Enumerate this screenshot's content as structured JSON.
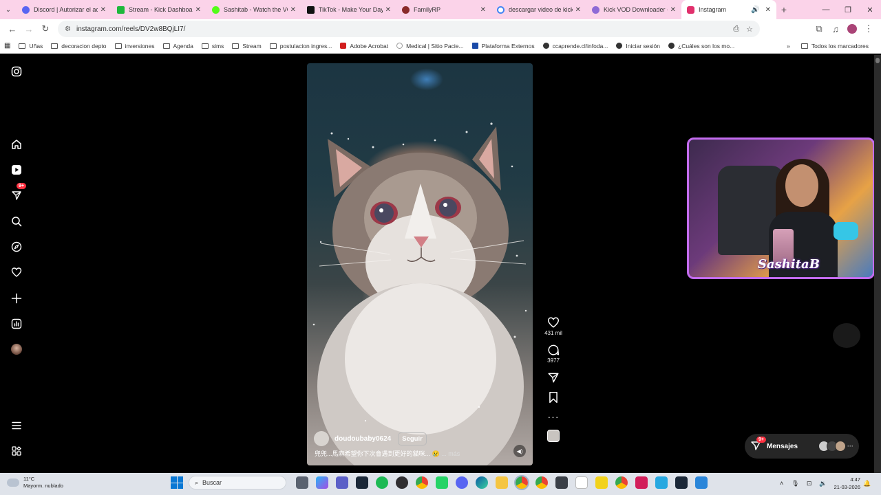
{
  "browser": {
    "tabs": [
      {
        "title": "Discord | Autorizar el acceso",
        "color": "#5865f2"
      },
      {
        "title": "Stream - Kick Dashboard",
        "color": "#1eb83c"
      },
      {
        "title": "Sashitab - Watch the VOD",
        "color": "#53fc18"
      },
      {
        "title": "TikTok - Make Your Day",
        "color": "#111111"
      },
      {
        "title": "FamilyRP",
        "color": "#8a2a2a"
      },
      {
        "title": "descargar video de kick - Google",
        "color": "#4285f4"
      },
      {
        "title": "Kick VOD Downloader - S",
        "color": "#8e6ad6"
      },
      {
        "title": "Instagram",
        "color": "#e1306c",
        "active": true
      }
    ],
    "url": "instagram.com/reels/DV2w8BQjLI7/",
    "bookmarks": [
      "Uñas",
      "decoracion depto",
      "inversiones",
      "Agenda",
      "sims",
      "Stream",
      "postulacion ingres...",
      "Adobe Acrobat",
      "Medical | Sitio Pacie...",
      "Plataforma Externos",
      "ccaprende.cl/infoda...",
      "Iniciar sesión",
      "¿Cuáles son los mo..."
    ],
    "bookmarks_more": "»",
    "all_bookmarks": "Todos los marcadores"
  },
  "instagram": {
    "nav": [
      "instagram-icon",
      "home-icon",
      "reels-icon",
      "messages-icon",
      "search-icon",
      "explore-icon",
      "notifications-icon",
      "create-icon",
      "dashboard-icon",
      "profile-avatar"
    ],
    "messages_badge": "9+",
    "reel": {
      "username": "doudoubaby0624",
      "follow_label": "Seguir",
      "caption": "兜兜...馬麻希望你下次會遇到更好的貓咪...",
      "more_label": "... más",
      "likes": "431 mil",
      "comments": "3977"
    },
    "messages_label": "Mensajes",
    "messages_count": "9+",
    "overlay_brand": "SashitaB"
  },
  "taskbar": {
    "weather_temp": "11°C",
    "weather_desc": "Mayorm. nublado",
    "search_label": "Buscar",
    "time": "4:47",
    "date": "21-03-2026"
  }
}
